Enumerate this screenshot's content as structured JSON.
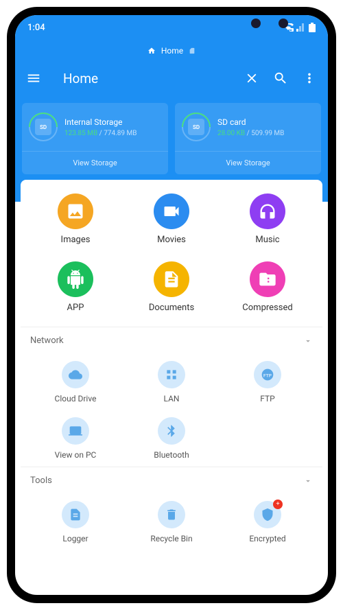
{
  "status": {
    "time": "1:04"
  },
  "breadcrumb": {
    "label": "Home"
  },
  "toolbar": {
    "title": "Home"
  },
  "storage": [
    {
      "name": "Internal Storage",
      "used": "123.85 MB",
      "total": "774.89 MB",
      "action": "View Storage",
      "chip": "SD"
    },
    {
      "name": "SD card",
      "used": "28.00 KB",
      "total": "509.99 MB",
      "action": "View Storage",
      "chip": "SD"
    }
  ],
  "categories": [
    {
      "label": "Images",
      "color": "#f5a623"
    },
    {
      "label": "Movies",
      "color": "#2b8cf0"
    },
    {
      "label": "Music",
      "color": "#8e3ef2"
    },
    {
      "label": "APP",
      "color": "#1bbf5c"
    },
    {
      "label": "Documents",
      "color": "#f5b400"
    },
    {
      "label": "Compressed",
      "color": "#ef3fb5"
    }
  ],
  "sections": {
    "network": {
      "title": "Network",
      "items": [
        {
          "label": "Cloud Drive"
        },
        {
          "label": "LAN"
        },
        {
          "label": "FTP"
        },
        {
          "label": "View on PC"
        },
        {
          "label": "Bluetooth"
        }
      ]
    },
    "tools": {
      "title": "Tools",
      "items": [
        {
          "label": "Logger"
        },
        {
          "label": "Recycle Bin"
        },
        {
          "label": "Encrypted"
        }
      ]
    }
  }
}
